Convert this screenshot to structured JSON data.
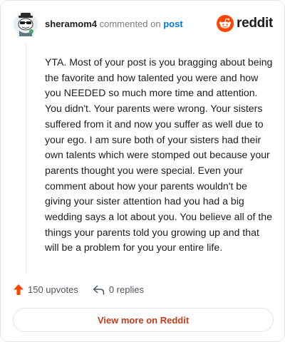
{
  "header": {
    "author": "sheramom4",
    "commented_text": "commented on",
    "post_link": "post",
    "brand": "reddit"
  },
  "comment": {
    "body": "YTA. Most of your post is you bragging about being the favorite and how talented you were and how you NEEDED so much more time and attention. You didn't. Your parents were wrong. Your sisters suffered from it and now you suffer as well due to your ego. I am sure both of your sisters had their own talents which were stomped out because your parents thought you were special. Even your comment about how your parents wouldn't be giving your sister attention had you had a big wedding says a lot about you. You believe all of the things your parents told you growing up and that will be a problem for you your entire life."
  },
  "actions": {
    "upvotes": "150 upvotes",
    "replies": "0 replies"
  },
  "footer": {
    "view_more": "View more on Reddit"
  },
  "colors": {
    "upvote": "#ff4500",
    "link": "#0079d3",
    "view_more_text": "#c23c1a"
  },
  "icons": {
    "avatar": "snoo-avatar-icon",
    "brand": "reddit-logo-icon",
    "upvote": "upvote-arrow-icon",
    "reply": "reply-arrow-icon"
  }
}
